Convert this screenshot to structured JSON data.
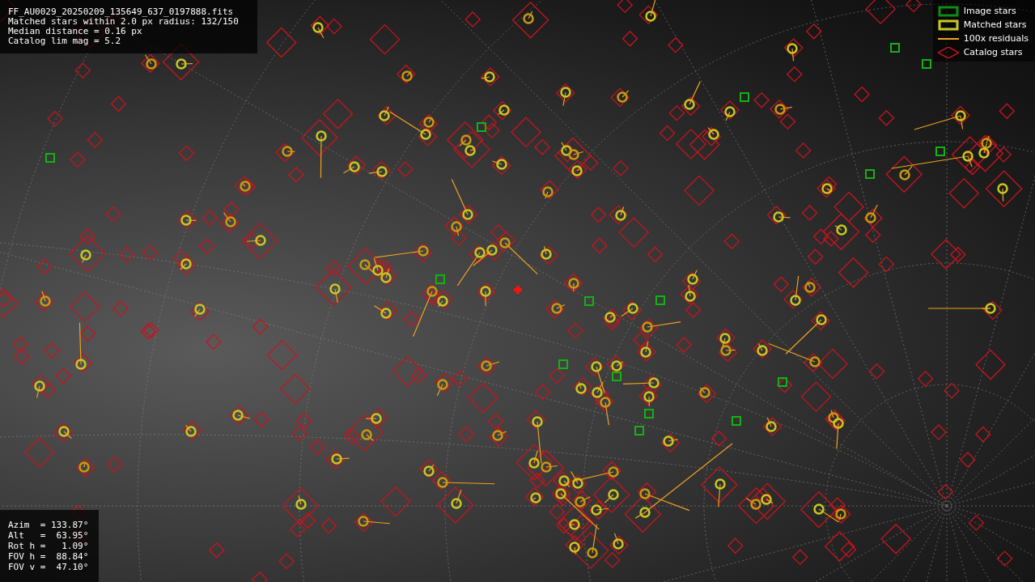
{
  "info_panel": {
    "lines": [
      "FF_AU0029_20250209_135649_637_0197888.fits",
      "Matched stars within 2.0 px radius: 132/150",
      "Median distance = 0.16 px",
      "Catalog lim mag = 5.2"
    ]
  },
  "legend": [
    {
      "kind": "image",
      "label": "Image stars"
    },
    {
      "kind": "matched",
      "label": "Matched stars"
    },
    {
      "kind": "residual",
      "label": "100x residuals"
    },
    {
      "kind": "catalog",
      "label": "Catalog stars"
    }
  ],
  "pointing_panel": {
    "lines": [
      "Azim  = 133.87°",
      "Alt   =  63.95°",
      "Rot h =   1.09°",
      "FOV h =  88.84°",
      "FOV v =  47.10°"
    ]
  }
}
